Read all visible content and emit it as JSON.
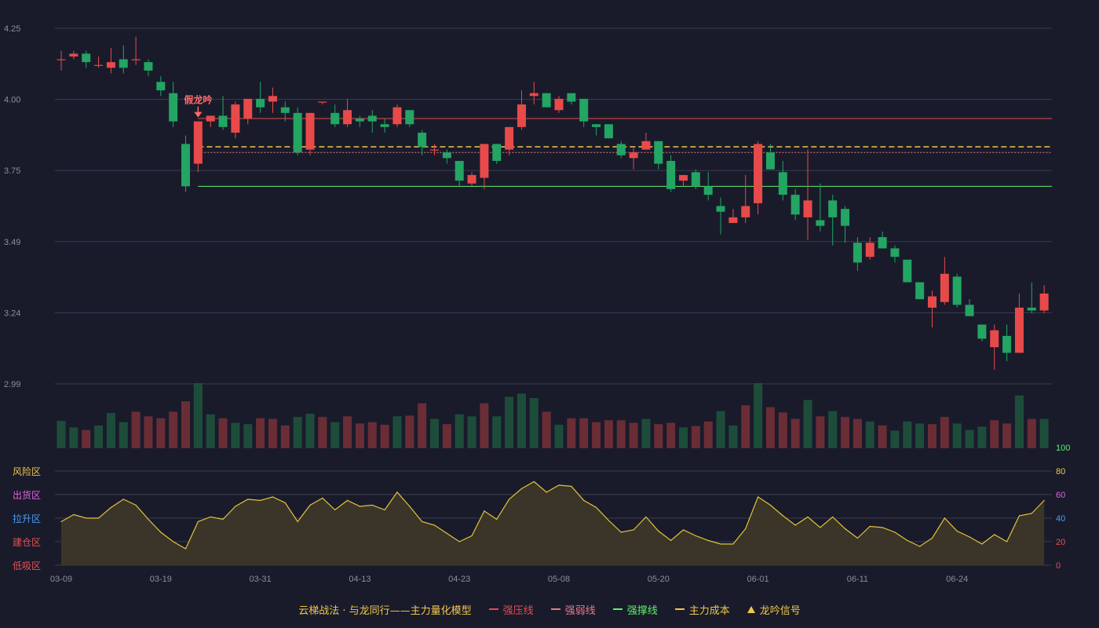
{
  "chart_data": [
    {
      "type": "candlestick",
      "ylim": [
        2.99,
        4.25
      ],
      "yticks": [
        "4.25",
        "4.00",
        "3.75",
        "3.49",
        "3.24",
        "2.99"
      ],
      "annotation": {
        "text": "假龙吟",
        "index": 11
      },
      "lines": [
        {
          "name": "强压线",
          "value": 3.93,
          "from_index": 11,
          "color": "#e84a4a",
          "style": "solid"
        },
        {
          "name": "主力成本",
          "value": 3.83,
          "from_index": 11,
          "color": "#f0c64a",
          "style": "dashed"
        },
        {
          "name": "强弱线",
          "value": 3.81,
          "from_index": 11,
          "color": "#e87a8a",
          "style": "dotted"
        },
        {
          "name": "强撑线",
          "value": 3.69,
          "from_index": 11,
          "color": "#5cf06a",
          "style": "solid"
        }
      ],
      "candles": [
        [
          4.14,
          4.14,
          4.17,
          4.1
        ],
        [
          4.15,
          4.16,
          4.17,
          4.14
        ],
        [
          4.16,
          4.13,
          4.17,
          4.11
        ],
        [
          4.12,
          4.12,
          4.15,
          4.11
        ],
        [
          4.11,
          4.13,
          4.18,
          4.09
        ],
        [
          4.14,
          4.11,
          4.19,
          4.09
        ],
        [
          4.14,
          4.14,
          4.22,
          4.12
        ],
        [
          4.13,
          4.1,
          4.14,
          4.08
        ],
        [
          4.06,
          4.03,
          4.08,
          4.01
        ],
        [
          4.02,
          3.92,
          4.06,
          3.9
        ],
        [
          3.84,
          3.69,
          3.87,
          3.67
        ],
        [
          3.77,
          3.92,
          3.92,
          3.74
        ],
        [
          3.92,
          3.94,
          3.94,
          3.9
        ],
        [
          3.94,
          3.9,
          4.01,
          3.89
        ],
        [
          3.88,
          3.98,
          3.99,
          3.86
        ],
        [
          3.93,
          4.0,
          4.0,
          3.91
        ],
        [
          4.0,
          3.97,
          4.06,
          3.95
        ],
        [
          3.99,
          4.01,
          4.04,
          3.95
        ],
        [
          3.97,
          3.95,
          3.99,
          3.92
        ],
        [
          3.95,
          3.81,
          3.97,
          3.8
        ],
        [
          3.82,
          3.95,
          3.95,
          3.8
        ],
        [
          3.99,
          3.99,
          3.99,
          3.98
        ],
        [
          3.95,
          3.91,
          3.98,
          3.9
        ],
        [
          3.91,
          3.96,
          4.0,
          3.9
        ],
        [
          3.93,
          3.92,
          3.94,
          3.9
        ],
        [
          3.94,
          3.92,
          3.96,
          3.88
        ],
        [
          3.91,
          3.9,
          3.93,
          3.88
        ],
        [
          3.91,
          3.97,
          3.98,
          3.9
        ],
        [
          3.96,
          3.91,
          3.96,
          3.9
        ],
        [
          3.88,
          3.83,
          3.89,
          3.8
        ],
        [
          3.82,
          3.82,
          3.84,
          3.8
        ],
        [
          3.81,
          3.79,
          3.82,
          3.77
        ],
        [
          3.78,
          3.71,
          3.78,
          3.69
        ],
        [
          3.7,
          3.73,
          3.74,
          3.69
        ],
        [
          3.72,
          3.84,
          3.84,
          3.68
        ],
        [
          3.84,
          3.78,
          3.84,
          3.77
        ],
        [
          3.82,
          3.9,
          3.9,
          3.8
        ],
        [
          3.9,
          3.98,
          4.03,
          3.89
        ],
        [
          4.01,
          4.02,
          4.06,
          3.98
        ],
        [
          4.02,
          3.97,
          4.02,
          3.97
        ],
        [
          3.96,
          4.0,
          4.01,
          3.95
        ],
        [
          4.02,
          3.99,
          4.02,
          3.98
        ],
        [
          4.0,
          3.92,
          4.0,
          3.9
        ],
        [
          3.91,
          3.9,
          3.91,
          3.87
        ],
        [
          3.91,
          3.86,
          3.91,
          3.86
        ],
        [
          3.84,
          3.8,
          3.85,
          3.79
        ],
        [
          3.79,
          3.81,
          3.83,
          3.75
        ],
        [
          3.82,
          3.85,
          3.88,
          3.82
        ],
        [
          3.85,
          3.77,
          3.85,
          3.75
        ],
        [
          3.78,
          3.68,
          3.8,
          3.67
        ],
        [
          3.71,
          3.73,
          3.73,
          3.69
        ],
        [
          3.74,
          3.69,
          3.75,
          3.68
        ],
        [
          3.69,
          3.66,
          3.74,
          3.64
        ],
        [
          3.62,
          3.6,
          3.65,
          3.52
        ],
        [
          3.56,
          3.58,
          3.61,
          3.56
        ],
        [
          3.58,
          3.62,
          3.73,
          3.56
        ],
        [
          3.63,
          3.84,
          3.85,
          3.59
        ],
        [
          3.81,
          3.75,
          3.84,
          3.75
        ],
        [
          3.74,
          3.66,
          3.78,
          3.64
        ],
        [
          3.66,
          3.59,
          3.68,
          3.57
        ],
        [
          3.58,
          3.64,
          3.82,
          3.5
        ],
        [
          3.57,
          3.55,
          3.7,
          3.53
        ],
        [
          3.64,
          3.58,
          3.66,
          3.48
        ],
        [
          3.61,
          3.55,
          3.62,
          3.49
        ],
        [
          3.49,
          3.42,
          3.51,
          3.39
        ],
        [
          3.44,
          3.49,
          3.51,
          3.43
        ],
        [
          3.51,
          3.47,
          3.53,
          3.47
        ],
        [
          3.47,
          3.44,
          3.48,
          3.42
        ],
        [
          3.43,
          3.35,
          3.43,
          3.35
        ],
        [
          3.35,
          3.29,
          3.35,
          3.29
        ],
        [
          3.26,
          3.3,
          3.32,
          3.19
        ],
        [
          3.28,
          3.38,
          3.44,
          3.27
        ],
        [
          3.37,
          3.27,
          3.38,
          3.26
        ],
        [
          3.27,
          3.23,
          3.29,
          3.23
        ],
        [
          3.2,
          3.15,
          3.2,
          3.14
        ],
        [
          3.12,
          3.18,
          3.2,
          3.04
        ],
        [
          3.16,
          3.1,
          3.2,
          3.07
        ],
        [
          3.1,
          3.26,
          3.31,
          3.1
        ],
        [
          3.26,
          3.25,
          3.35,
          3.24
        ],
        [
          3.25,
          3.31,
          3.34,
          3.24
        ]
      ]
    },
    {
      "type": "bar",
      "name": "volume",
      "values": [
        42,
        32,
        28,
        35,
        54,
        40,
        56,
        49,
        46,
        56,
        72,
        100,
        52,
        46,
        39,
        37,
        46,
        45,
        35,
        48,
        53,
        48,
        40,
        49,
        38,
        40,
        36,
        49,
        50,
        69,
        45,
        37,
        52,
        49,
        69,
        49,
        79,
        84,
        77,
        56,
        36,
        46,
        46,
        40,
        43,
        43,
        39,
        45,
        37,
        39,
        32,
        34,
        41,
        57,
        35,
        66,
        100,
        63,
        55,
        45,
        74,
        49,
        57,
        48,
        45,
        41,
        35,
        27,
        41,
        38,
        37,
        48,
        38,
        28,
        33,
        43,
        38,
        81,
        45,
        45
      ],
      "colors": [
        "g",
        "g",
        "r",
        "g",
        "g",
        "g",
        "r",
        "r",
        "r",
        "r",
        "r",
        "g",
        "g",
        "r",
        "g",
        "g",
        "r",
        "r",
        "r",
        "g",
        "g",
        "r",
        "g",
        "r",
        "r",
        "r",
        "r",
        "g",
        "r",
        "r",
        "g",
        "r",
        "g",
        "g",
        "r",
        "g",
        "g",
        "g",
        "g",
        "r",
        "g",
        "r",
        "r",
        "r",
        "r",
        "r",
        "r",
        "g",
        "r",
        "r",
        "g",
        "r",
        "r",
        "g",
        "g",
        "r",
        "g",
        "r",
        "r",
        "r",
        "g",
        "r",
        "g",
        "r",
        "r",
        "g",
        "r",
        "g",
        "g",
        "g",
        "r",
        "r",
        "g",
        "g",
        "g",
        "r",
        "r",
        "g",
        "r",
        "g"
      ]
    },
    {
      "type": "area",
      "name": "主力量化模型",
      "ylim": [
        0,
        100
      ],
      "yticks": [
        "100",
        "80",
        "60",
        "40",
        "20",
        "0"
      ],
      "zones": [
        "风险区",
        "出货区",
        "拉升区",
        "建仓区",
        "低吸区"
      ],
      "values": [
        37,
        43,
        40,
        40,
        49,
        56,
        51,
        39,
        28,
        20,
        14,
        37,
        41,
        39,
        50,
        56,
        55,
        58,
        53,
        37,
        51,
        57,
        47,
        55,
        50,
        51,
        47,
        62,
        50,
        37,
        34,
        27,
        20,
        25,
        46,
        39,
        56,
        65,
        71,
        62,
        68,
        67,
        55,
        49,
        38,
        28,
        30,
        41,
        29,
        21,
        30,
        25,
        21,
        18,
        18,
        31,
        58,
        51,
        42,
        34,
        41,
        32,
        41,
        31,
        23,
        33,
        32,
        28,
        21,
        16,
        23,
        40,
        29,
        24,
        18,
        26,
        20,
        42,
        44,
        55
      ],
      "categories": [
        "03-09",
        "03-19",
        "03-31",
        "04-13",
        "04-23",
        "05-08",
        "05-20",
        "06-01",
        "06-11",
        "06-24"
      ],
      "category_index": [
        0,
        8,
        16,
        24,
        32,
        40,
        48,
        56,
        64,
        72
      ]
    }
  ],
  "legend": {
    "title": "云梯战法 · 与龙同行——主力量化模型",
    "items": [
      {
        "label": "强压线",
        "color": "#e84a4a",
        "kind": "line"
      },
      {
        "label": "强弱线",
        "color": "#e87a8a",
        "kind": "dash"
      },
      {
        "label": "强撑线",
        "color": "#5cf06a",
        "kind": "line"
      },
      {
        "label": "主力成本",
        "color": "#f0c64a",
        "kind": "dash"
      },
      {
        "label": "龙吟信号",
        "color": "#f0c64a",
        "kind": "triangle"
      }
    ]
  },
  "colors": {
    "up": "#e84a4a",
    "down": "#23a563",
    "vol_up": "#6a2d35",
    "vol_down": "#1d4d3a",
    "grid": "#3a3d4e",
    "axis_text": "#8a8e9a",
    "line": "#e4c23a",
    "area": "#3a3528",
    "zone_colors": [
      "#f0c64a",
      "#e060e0",
      "#4c9cf0",
      "#e85050",
      "#e85050"
    ],
    "indicator_tick_colors": [
      "#5cf06a",
      "#f0c64a",
      "#e060e0",
      "#4c9cf0",
      "#e85050",
      "#e85050"
    ]
  }
}
